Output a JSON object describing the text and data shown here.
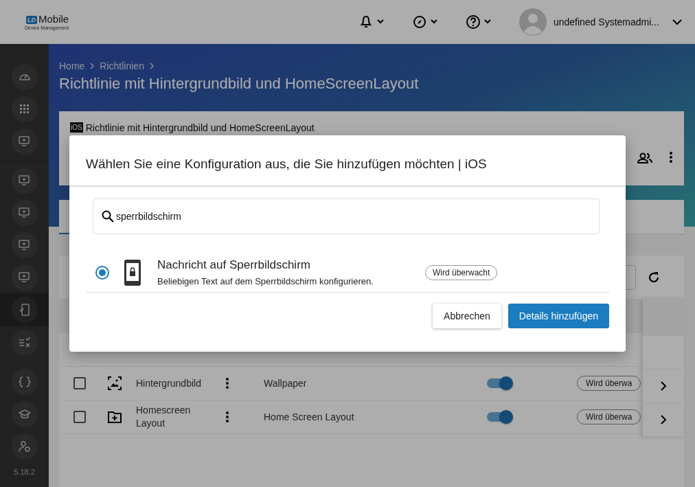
{
  "header": {
    "logo_mark": "LD",
    "logo_title": "Mobile",
    "logo_subtitle": "Device Management",
    "user_name": "undefined Systemadmi..."
  },
  "sidebar": {
    "groups": [
      [
        {
          "selected": false
        },
        {
          "selected": false
        },
        {
          "selected": false
        }
      ],
      [
        {
          "selected": false
        },
        {
          "selected": false
        },
        {
          "selected": false
        },
        {
          "selected": false
        },
        {
          "selected": true
        },
        {
          "selected": false
        }
      ],
      [
        {
          "selected": false
        },
        {
          "selected": false
        },
        {
          "selected": false
        }
      ]
    ],
    "version": "5.18.2"
  },
  "breadcrumb": [
    "Home",
    "Richtlinien"
  ],
  "page_title": "Richtlinie mit Hintergrundbild und HomeScreenLayout",
  "policy_card": {
    "platform": "iOS",
    "title": "Richtlinie mit Hintergrundbild und HomeScreenLayout"
  },
  "table": {
    "rows": [
      {
        "checked": false,
        "name": "Hintergrundbild",
        "type": "Wallpaper",
        "enabled": true,
        "status": "Wird überwa"
      },
      {
        "checked": false,
        "name": "Homescreen Layout",
        "type": "Home Screen Layout",
        "enabled": true,
        "status": "Wird überwa"
      }
    ]
  },
  "dialog": {
    "title": "Wählen Sie eine Konfiguration aus, die Sie hinzufügen möchten | iOS",
    "search": {
      "value": "sperrbildschirm"
    },
    "options": [
      {
        "selected": true,
        "title": "Nachricht auf Sperrbildschirm",
        "description": "Beliebigen Text auf dem Sperrbildschirm konfigurieren.",
        "badge": "Wird überwacht"
      }
    ],
    "buttons": {
      "cancel": "Abbrechen",
      "confirm": "Details hinzufügen"
    }
  }
}
